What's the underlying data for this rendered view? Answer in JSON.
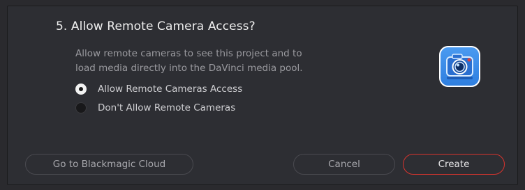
{
  "dialog": {
    "title": "5. Allow Remote Camera Access?",
    "description_lines": [
      "Allow remote cameras to see this project and to",
      "load media directly into the DaVinci media pool."
    ],
    "options": [
      {
        "label": "Allow Remote Cameras Access",
        "selected": true
      },
      {
        "label": "Don't Allow Remote Cameras",
        "selected": false
      }
    ],
    "icon": "remote-camera-app-icon"
  },
  "buttons": {
    "cloud": "Go to Blackmagic Cloud",
    "cancel": "Cancel",
    "create": "Create"
  },
  "colors": {
    "background": "#2d2e33",
    "accent_border": "#d8342e",
    "icon_blue": "#3a8ce8"
  }
}
